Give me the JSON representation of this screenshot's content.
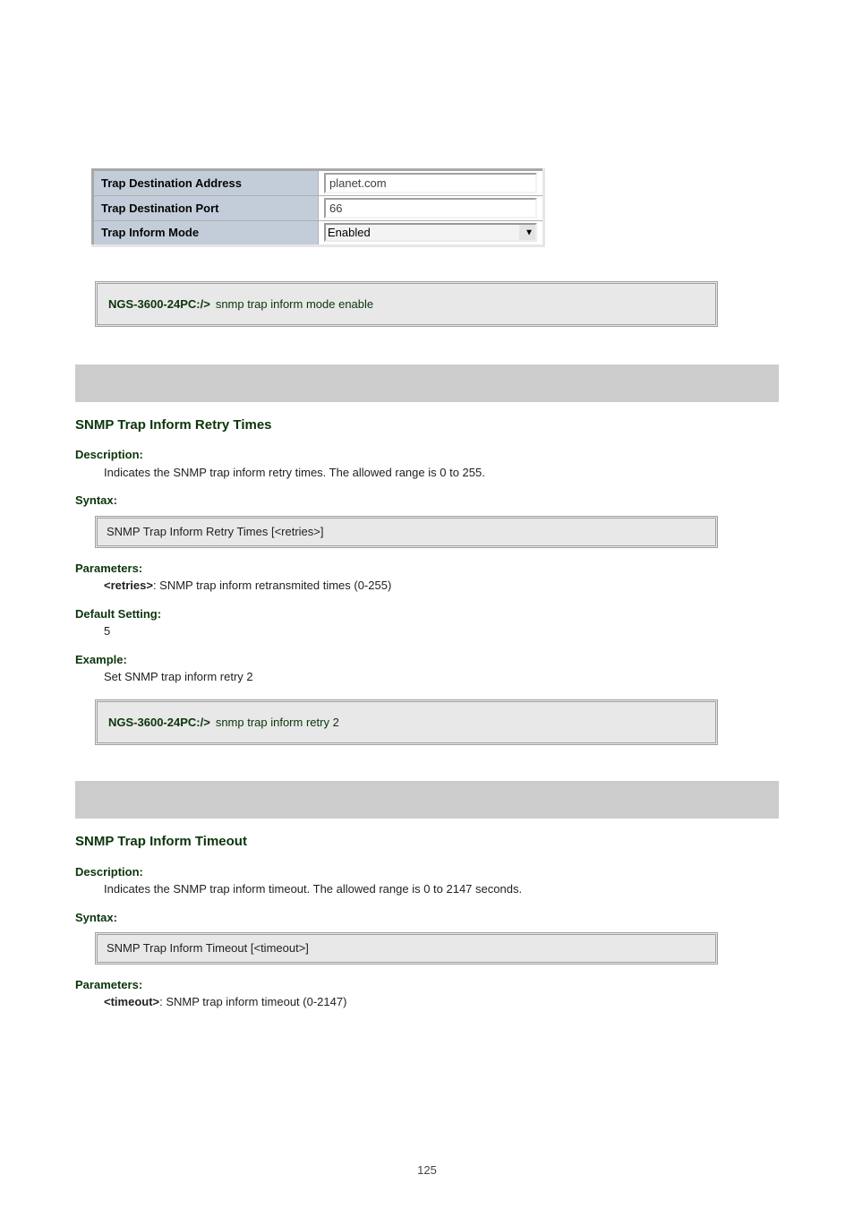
{
  "config_table": {
    "rows": [
      {
        "label": "Trap Destination Address",
        "kind": "text",
        "value": "planet.com"
      },
      {
        "label": "Trap Destination Port",
        "kind": "text",
        "value": "66"
      },
      {
        "label": "Trap Inform Mode",
        "kind": "select",
        "value": "Enabled"
      }
    ]
  },
  "note1": {
    "lead": "NGS-3600-24PC:/>",
    "body": "snmp trap inform mode enable"
  },
  "section_retry": {
    "title": "SNMP Trap Inform Retry Times",
    "description": "Indicates the SNMP trap inform retry times. The allowed range is 0 to 255.",
    "syntax_lead": "Syntax:",
    "syntax_body": "SNMP Trap Inform Retry Times [<retries>]",
    "parameters_label": "Parameters:",
    "parameters_name": "<retries>",
    "parameters_desc": ": SNMP trap inform retransmited times (0-255)",
    "default_lead": "Default Setting:",
    "default_value": "5",
    "example_lead": "Example:",
    "example_text": "Set SNMP trap inform retry 2"
  },
  "note2": {
    "lead": "NGS-3600-24PC:/>",
    "body": "snmp trap inform retry 2"
  },
  "section_timeout": {
    "title": "SNMP Trap Inform Timeout",
    "description": "Indicates the SNMP trap inform timeout. The allowed range is 0 to 2147 seconds.",
    "syntax_lead": "Syntax:",
    "syntax_body": "SNMP Trap Inform Timeout [<timeout>]",
    "parameters_label": "Parameters:",
    "parameters_name": "<timeout>",
    "parameters_desc": ": SNMP trap inform timeout (0-2147)"
  },
  "page_number": "125"
}
